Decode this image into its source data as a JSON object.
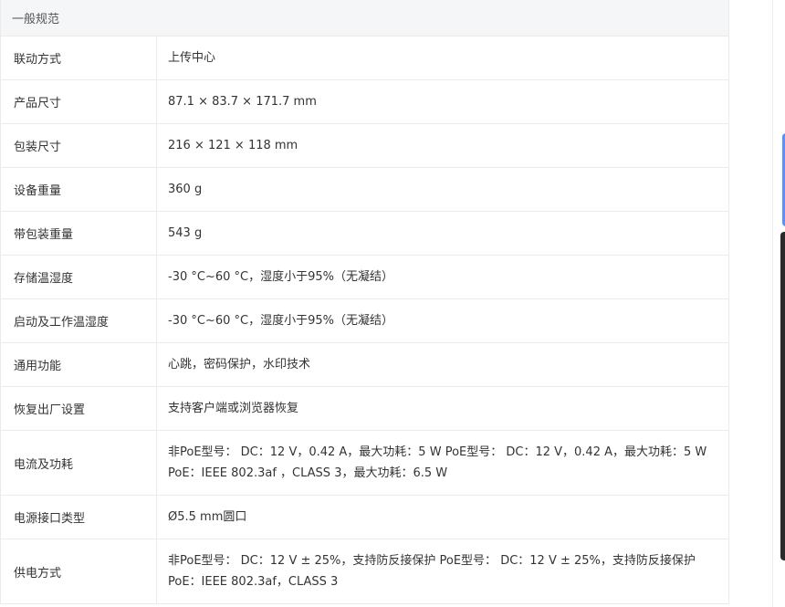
{
  "section": {
    "title": "一般规范"
  },
  "rows": [
    {
      "label": "联动方式",
      "value": "上传中心"
    },
    {
      "label": "产品尺寸",
      "value": "87.1 × 83.7 × 171.7 mm"
    },
    {
      "label": "包装尺寸",
      "value": "216 × 121 × 118 mm"
    },
    {
      "label": "设备重量",
      "value": "360 g"
    },
    {
      "label": "带包装重量",
      "value": "543 g"
    },
    {
      "label": "存储温湿度",
      "value": "-30 °C~60 °C，湿度小于95%（无凝结）"
    },
    {
      "label": "启动及工作温湿度",
      "value": "-30 °C~60 °C，湿度小于95%（无凝结）"
    },
    {
      "label": "通用功能",
      "value": "心跳，密码保护，水印技术"
    },
    {
      "label": "恢复出厂设置",
      "value": "支持客户端或浏览器恢复"
    },
    {
      "label": "电流及功耗",
      "value": "非PoE型号： DC：12 V，0.42 A，最大功耗：5 W PoE型号： DC：12 V，0.42 A，最大功耗：5 W PoE：IEEE 802.3af ，CLASS 3，最大功耗：6.5 W"
    },
    {
      "label": "电源接口类型",
      "value": "Ø5.5 mm圆口"
    },
    {
      "label": "供电方式",
      "value": "非PoE型号： DC：12 V ± 25%，支持防反接保护 PoE型号： DC：12 V ± 25%，支持防反接保护 PoE：IEEE 802.3af，CLASS 3"
    }
  ]
}
